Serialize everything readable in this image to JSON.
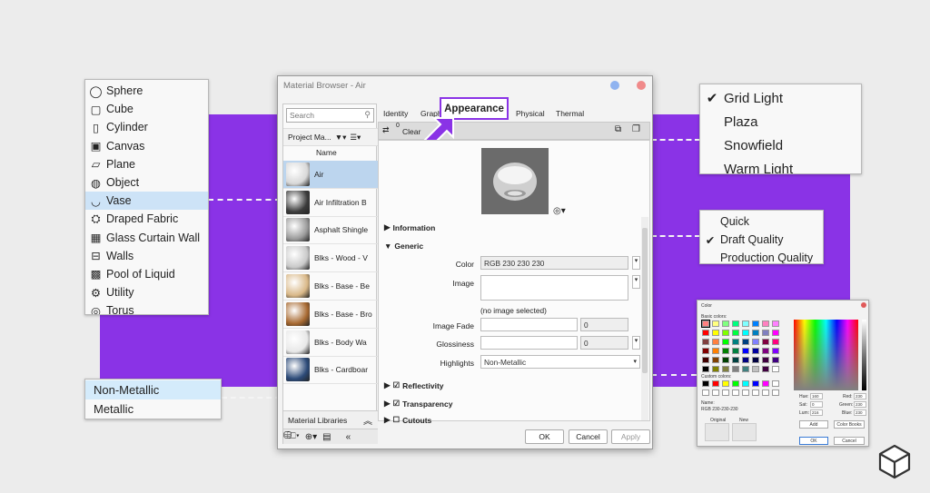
{
  "shape_menu": {
    "items": [
      {
        "label": "Sphere",
        "icon": "sphere-icon",
        "selected": false
      },
      {
        "label": "Cube",
        "icon": "cube-icon",
        "selected": false
      },
      {
        "label": "Cylinder",
        "icon": "cylinder-icon",
        "selected": false
      },
      {
        "label": "Canvas",
        "icon": "canvas-icon",
        "selected": false
      },
      {
        "label": "Plane",
        "icon": "plane-icon",
        "selected": false
      },
      {
        "label": "Object",
        "icon": "object-icon",
        "selected": false
      },
      {
        "label": "Vase",
        "icon": "vase-icon",
        "selected": true
      },
      {
        "label": "Draped Fabric",
        "icon": "draped-fabric-icon",
        "selected": false
      },
      {
        "label": "Glass Curtain Wall",
        "icon": "glass-curtain-wall-icon",
        "selected": false
      },
      {
        "label": "Walls",
        "icon": "walls-icon",
        "selected": false
      },
      {
        "label": "Pool of Liquid",
        "icon": "pool-of-liquid-icon",
        "selected": false
      },
      {
        "label": "Utility",
        "icon": "utility-icon",
        "selected": false
      },
      {
        "label": "Torus",
        "icon": "torus-icon",
        "selected": false
      }
    ]
  },
  "environment_menu": {
    "items": [
      {
        "label": "Grid Light",
        "checked": true
      },
      {
        "label": "Plaza",
        "checked": false
      },
      {
        "label": "Snowfield",
        "checked": false
      },
      {
        "label": "Warm Light",
        "checked": false
      }
    ]
  },
  "quality_menu": {
    "items": [
      {
        "label": "Quick",
        "checked": false
      },
      {
        "label": "Draft Quality",
        "checked": true
      },
      {
        "label": "Production Quality",
        "checked": false
      }
    ]
  },
  "highlights_menu": {
    "items": [
      {
        "label": "Non-Metallic",
        "selected": true
      },
      {
        "label": "Metallic",
        "selected": false
      }
    ]
  },
  "dialog": {
    "title": "Material Browser - Air",
    "search_placeholder": "Search",
    "project_materials": "Project Ma...",
    "name_header": "Name",
    "materials": [
      {
        "name": "Air",
        "color": "#d8d8d8",
        "selected": true
      },
      {
        "name": "Air Infiltration B",
        "color": "#3c3c3c",
        "selected": false
      },
      {
        "name": "Asphalt Shingle",
        "color": "#9a9a9a",
        "selected": false
      },
      {
        "name": "Blks -  Wood - V",
        "color": "#c9c9c9",
        "selected": false
      },
      {
        "name": "Blks - Base - Be",
        "color": "#d9b888",
        "selected": false
      },
      {
        "name": "Blks - Base - Bro",
        "color": "#a86a32",
        "selected": false
      },
      {
        "name": "Blks - Body Wa",
        "color": "#e8e8e8",
        "selected": false
      },
      {
        "name": "Blks - Cardboar",
        "color": "#2c4a78",
        "selected": false
      }
    ],
    "material_libraries": "Material Libraries",
    "tabs": {
      "identity": "Identity",
      "graphics": "Graph",
      "appearance": "Appearance",
      "physical": "Physical",
      "thermal": "Thermal"
    },
    "clear_label": "Clear",
    "clear_count": "0",
    "sections": {
      "information": "Information",
      "generic": "Generic",
      "reflectivity": "Reflectivity",
      "transparency": "Transparency",
      "cutouts": "Cutouts"
    },
    "labels": {
      "color": "Color",
      "image": "Image",
      "image_fade": "Image Fade",
      "glossiness": "Glossiness",
      "highlights": "Highlights"
    },
    "values": {
      "color": "RGB 230 230 230",
      "no_image": "(no image selected)",
      "image_fade": "0",
      "glossiness": "0",
      "highlights": "Non-Metallic"
    },
    "reflectivity_checked": true,
    "transparency_checked": true,
    "cutouts_checked": false,
    "buttons": {
      "ok": "OK",
      "cancel": "Cancel",
      "apply": "Apply"
    }
  },
  "color_dialog": {
    "title": "Color",
    "basic_colors_label": "Basic colors:",
    "custom_colors_label": "Custom colors:",
    "name_label": "Name:",
    "name_value": "RGB 230-230-230",
    "original_label": "Original",
    "new_label": "New",
    "hue_label": "Hue:",
    "hue_value": "160",
    "sat_label": "Sat:",
    "sat_value": "0",
    "lum_label": "Lum:",
    "lum_value": "216",
    "red_label": "Red:",
    "red_value": "230",
    "green_label": "Green:",
    "green_value": "230",
    "blue_label": "Blue:",
    "blue_value": "230",
    "add_label": "Add",
    "color_books_label": "Color Books",
    "ok_label": "OK",
    "cancel_label": "Cancel",
    "basic_colors": [
      "#ff8080",
      "#ffff80",
      "#80ff80",
      "#00ff80",
      "#80ffff",
      "#0080ff",
      "#ff80c0",
      "#ff80ff",
      "#ff0000",
      "#ffff00",
      "#80ff00",
      "#00ff40",
      "#00ffff",
      "#0080c0",
      "#8080c0",
      "#ff00ff",
      "#804040",
      "#ff8040",
      "#00ff00",
      "#008080",
      "#004080",
      "#8080ff",
      "#800040",
      "#ff0080",
      "#800000",
      "#ff8000",
      "#008000",
      "#008040",
      "#0000ff",
      "#0000a0",
      "#800080",
      "#8000ff",
      "#400000",
      "#804000",
      "#004000",
      "#004040",
      "#000080",
      "#000040",
      "#400040",
      "#400080",
      "#000000",
      "#808000",
      "#808040",
      "#808080",
      "#408080",
      "#c0c0c0",
      "#400040",
      "#ffffff"
    ],
    "custom_colors": [
      "#000000",
      "#ff0000",
      "#ffff00",
      "#00ff00",
      "#00ffff",
      "#0000ff",
      "#ff00ff",
      "#ffffff",
      "#ffffff",
      "#ffffff",
      "#ffffff",
      "#ffffff",
      "#ffffff",
      "#ffffff",
      "#ffffff",
      "#ffffff"
    ]
  },
  "colors": {
    "accent": "#8a33e6"
  }
}
